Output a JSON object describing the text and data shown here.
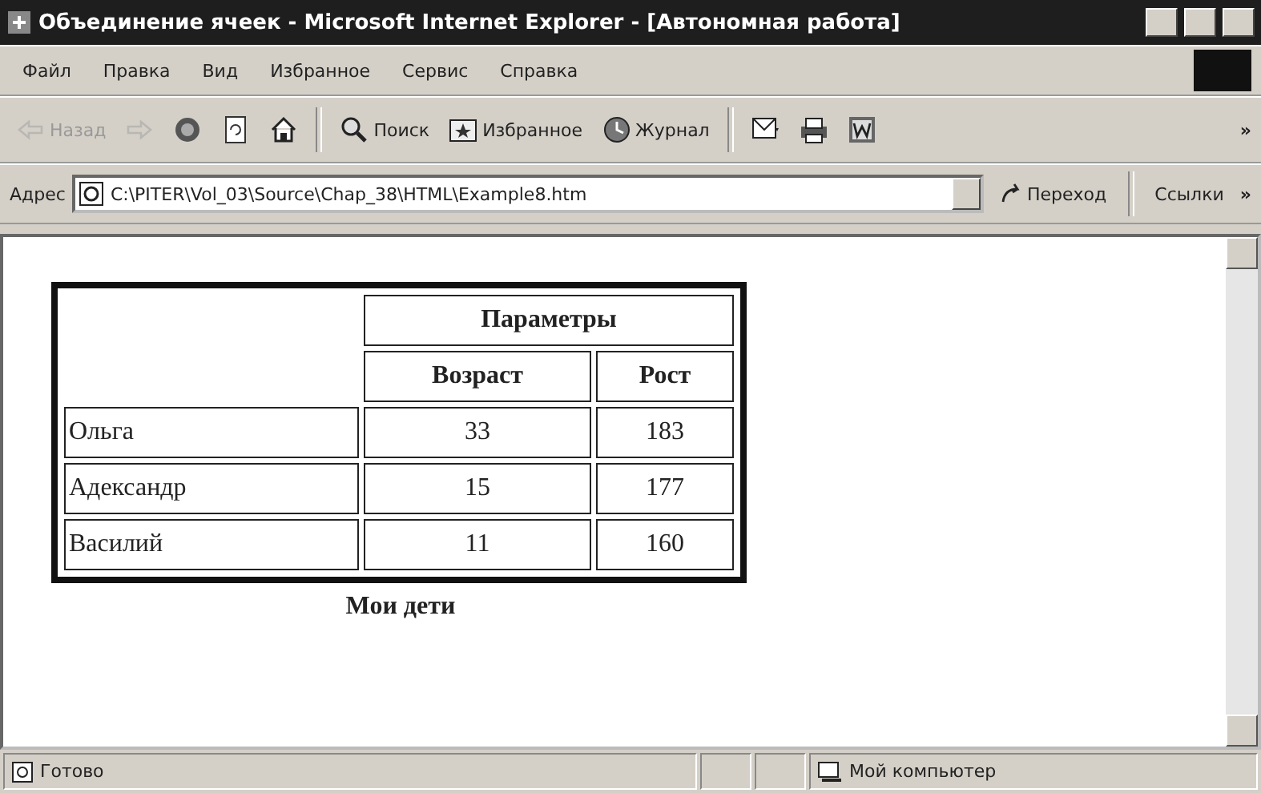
{
  "window": {
    "title": "Объединение ячеек - Microsoft Internet Explorer - [Автономная работа]"
  },
  "menu": [
    "Файл",
    "Правка",
    "Вид",
    "Избранное",
    "Сервис",
    "Справка"
  ],
  "toolbar": [
    {
      "kind": "back",
      "label": "Назад",
      "disabled": true
    },
    {
      "kind": "forward",
      "disabled": true
    },
    {
      "kind": "stop",
      "disabled": false
    },
    {
      "kind": "refresh",
      "disabled": false
    },
    {
      "kind": "home",
      "disabled": false
    },
    {
      "kind": "separator"
    },
    {
      "kind": "search",
      "label": "Поиск",
      "disabled": false
    },
    {
      "kind": "favorites",
      "label": "Избранное",
      "disabled": false
    },
    {
      "kind": "history",
      "label": "Журнал",
      "disabled": false
    },
    {
      "kind": "separator"
    },
    {
      "kind": "mail",
      "disabled": false
    },
    {
      "kind": "print",
      "disabled": false
    },
    {
      "kind": "edit",
      "disabled": false
    }
  ],
  "toolbar_more": "»",
  "address": {
    "label": "Адрес",
    "value": "C:\\PITER\\Vol_03\\Source\\Chap_38\\HTML\\Example8.htm",
    "go": "Переход",
    "links": "Ссылки",
    "links_more": "»"
  },
  "table": {
    "group_header": "Параметры",
    "columns": [
      "Возраст",
      "Рост"
    ],
    "rows": [
      {
        "name": "Ольга",
        "cells": [
          "33",
          "183"
        ]
      },
      {
        "name": "Адександр",
        "cells": [
          "15",
          "177"
        ]
      },
      {
        "name": "Василий",
        "cells": [
          "11",
          "160"
        ]
      }
    ],
    "caption": "Мои дети"
  },
  "status_bar": {
    "text": "Готово",
    "zone": "Мой компьютер"
  }
}
